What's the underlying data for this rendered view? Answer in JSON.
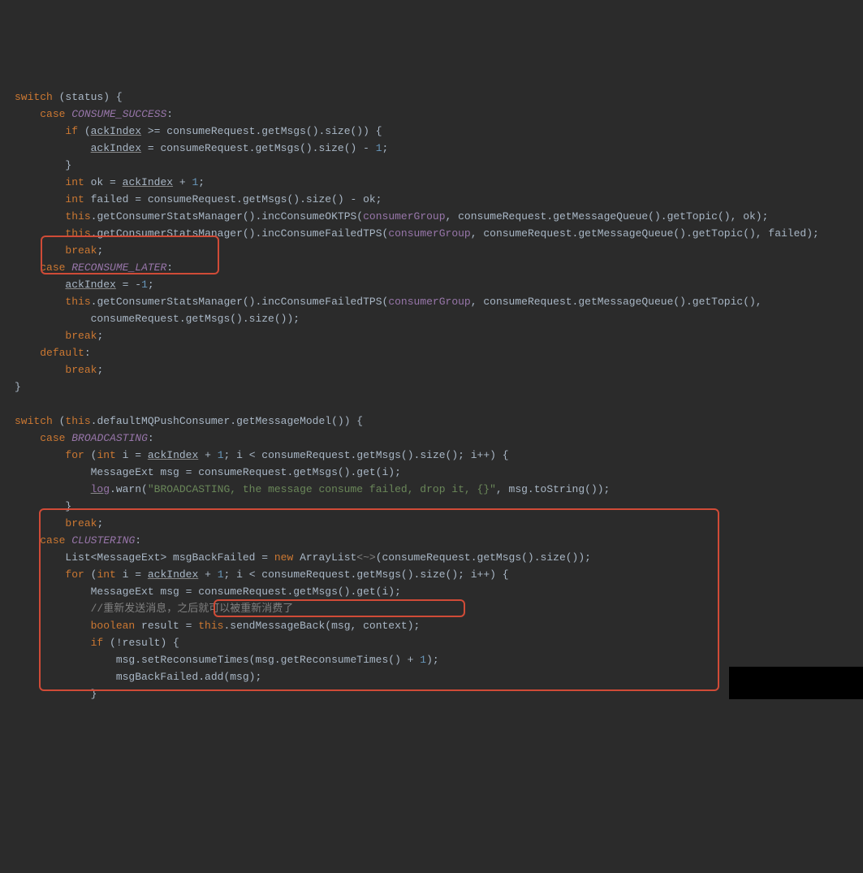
{
  "code": {
    "l1": {
      "kw_switch": "switch",
      "status": "status"
    },
    "l2": {
      "kw_case": "case",
      "c": "CONSUME_SUCCESS"
    },
    "l3": {
      "kw_if": "if",
      "ack": "ackIndex",
      "rest": " >= consumeRequest.getMsgs().size()) {"
    },
    "l4": {
      "ack": "ackIndex",
      "rest": " = consumeRequest.getMsgs().size() - ",
      "one": "1",
      ";": ";"
    },
    "l5": "        }",
    "l6": {
      "kw_int": "int",
      "ok": " ok = ",
      "ack": "ackIndex",
      "rest": " + ",
      "one": "1",
      ";": ";"
    },
    "l7": {
      "kw_int": "int",
      "rest": " failed = consumeRequest.getMsgs().size() - ok;"
    },
    "l8": {
      "this": "this",
      "m": ".getConsumerStatsManager().incConsumeOKTPS(",
      "cg": "consumerGroup",
      "rest": ", consumeRequest.getMessageQueue().getTopic(), ok);"
    },
    "l9": {
      "this": "this",
      "m": ".getConsumerStatsManager().incConsumeFailedTPS(",
      "cg": "consumerGroup",
      "rest": ", consumeRequest.getMessageQueue().getTopic(), failed);"
    },
    "l10": {
      "kw": "break",
      ";": ";"
    },
    "l11": {
      "kw_case": "case",
      "c": "RECONSUME_LATER"
    },
    "l12": {
      "ack": "ackIndex",
      "rest": " = -",
      "one": "1",
      ";": ";"
    },
    "l13": {
      "this": "this",
      "m": ".getConsumerStatsManager().incConsumeFailedTPS(",
      "cg": "consumerGroup",
      "rest": ", consumeRequest.getMessageQueue().getTopic(),"
    },
    "l14": "            consumeRequest.getMsgs().size());",
    "l15": {
      "kw": "break",
      ";": ";"
    },
    "l16": {
      "kw": "default",
      "c": ":"
    },
    "l17": {
      "kw": "break",
      ";": ";"
    },
    "l18": "}",
    "l20": {
      "kw_switch": "switch",
      "this": "this",
      "rest": ".defaultMQPushConsumer.getMessageModel()) {"
    },
    "l21": {
      "kw_case": "case",
      "c": "BROADCASTING"
    },
    "l22": {
      "kw_for": "for",
      "int": "int",
      "init": " i = ",
      "ack": "ackIndex",
      "rest1": " + ",
      "one": "1",
      "rest2": "; i < consumeRequest.getMsgs().size(); i++) {"
    },
    "l23": "            MessageExt msg = consumeRequest.getMsgs().get(i);",
    "l24": {
      "log": "log",
      "m": ".warn(",
      "s": "\"BROADCASTING, the message consume failed, drop it, {}\"",
      "rest": ", msg.toString());"
    },
    "l25": "        }",
    "l26": {
      "kw": "break",
      ";": ";"
    },
    "l27": {
      "kw_case": "case",
      "c": "CLUSTERING"
    },
    "l28": {
      "t1": "List<MessageExt> msgBackFailed = ",
      "kw_new": "new",
      "t2": " ArrayList",
      "diamond": "<~>",
      "t3": "(consumeRequest.getMsgs().size());"
    },
    "l29": {
      "kw_for": "for",
      "int": "int",
      "init": " i = ",
      "ack": "ackIndex",
      "rest1": " + ",
      "one": "1",
      "rest2": "; i < consumeRequest.getMsgs().size(); i++) {"
    },
    "l30": "            MessageExt msg = consumeRequest.getMsgs().get(i);",
    "l31": "            //重新发送消息，之后就可以被重新消费了",
    "l32": {
      "kw_bool": "boolean",
      "t1": " result = ",
      "this": "this",
      "rest": ".sendMessageBack(msg, context);"
    },
    "l33": {
      "kw_if": "if",
      "rest": " (!result) {"
    },
    "l34": {
      "t1": "                msg.setReconsumeTimes(msg.getReconsumeTimes() + ",
      "one": "1",
      "t2": ");"
    },
    "l35": "                msgBackFailed.add(msg);",
    "l36": "            }"
  }
}
